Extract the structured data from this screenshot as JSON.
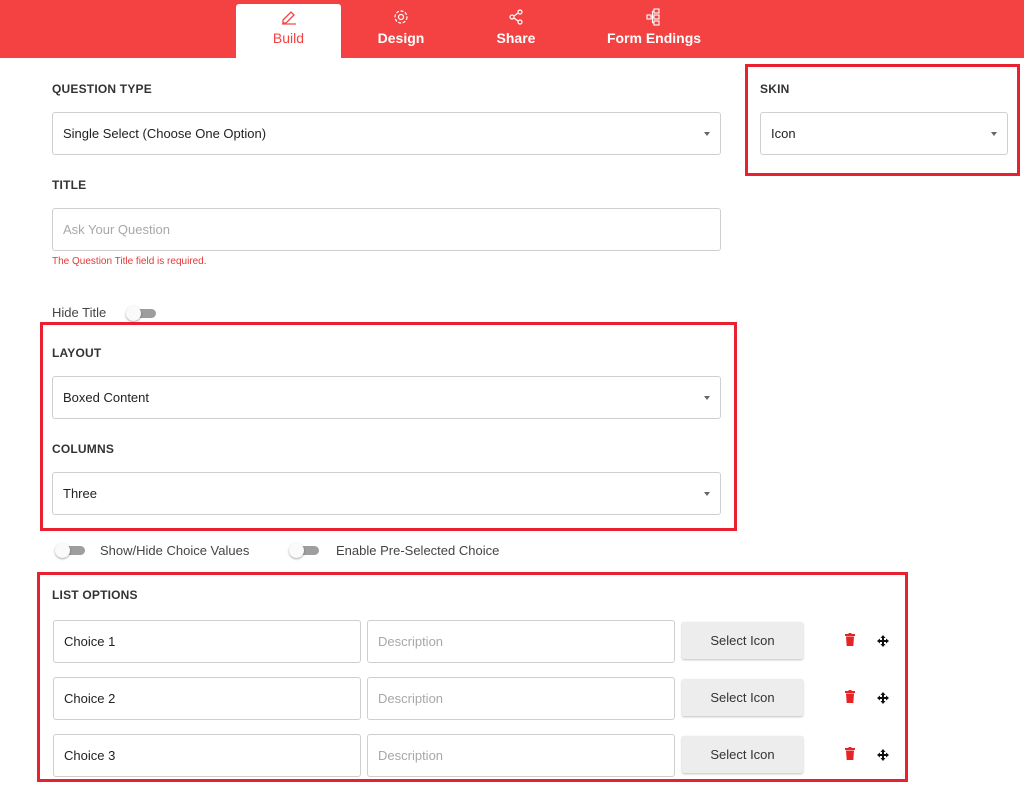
{
  "nav": {
    "tabs": [
      {
        "label": "Build",
        "icon": "edit-icon",
        "active": true
      },
      {
        "label": "Design",
        "icon": "gear-icon",
        "active": false
      },
      {
        "label": "Share",
        "icon": "share-icon",
        "active": false
      },
      {
        "label": "Form Endings",
        "icon": "flow-icon",
        "active": false
      }
    ]
  },
  "question_type": {
    "label": "QUESTION TYPE",
    "value": "Single Select (Choose One Option)"
  },
  "skin": {
    "label": "SKIN",
    "value": "Icon"
  },
  "title": {
    "label": "TITLE",
    "placeholder": "Ask Your Question",
    "error": "The Question Title field is required."
  },
  "hide_title": {
    "label": "Hide Title",
    "on": false
  },
  "layout": {
    "label": "LAYOUT",
    "value": "Boxed Content"
  },
  "columns": {
    "label": "COLUMNS",
    "value": "Three"
  },
  "toggles": {
    "show_hide_values": "Show/Hide Choice Values",
    "pre_selected": "Enable Pre-Selected Choice"
  },
  "list_options": {
    "label": "LIST OPTIONS",
    "items": [
      {
        "choice": "Choice 1",
        "description_placeholder": "Description",
        "button": "Select Icon"
      },
      {
        "choice": "Choice 2",
        "description_placeholder": "Description",
        "button": "Select Icon"
      },
      {
        "choice": "Choice 3",
        "description_placeholder": "Description",
        "button": "Select Icon"
      }
    ]
  },
  "colors": {
    "accent": "#f44242",
    "highlight": "#e8202f",
    "error": "#e53935",
    "trash": "#e82323"
  }
}
